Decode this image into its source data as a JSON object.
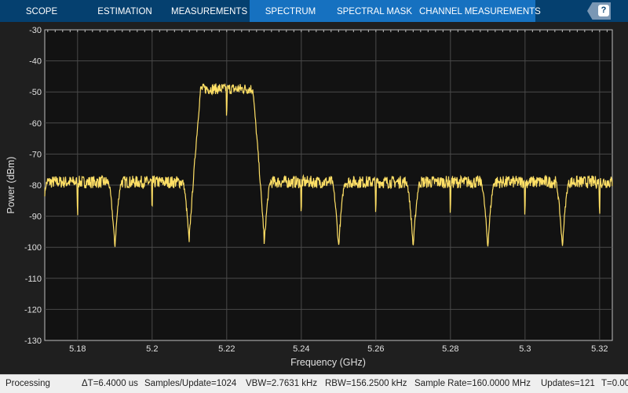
{
  "tabs": {
    "scope": "SCOPE",
    "estimation": "ESTIMATION",
    "measurements": "MEASUREMENTS",
    "spectrum": "SPECTRUM",
    "spectral_mask": "SPECTRAL MASK",
    "channel_measurements": "CHANNEL MEASUREMENTS",
    "help": "?"
  },
  "colors": {
    "trace": "#ffe066",
    "tabbar": "#05406f",
    "active_group": "#1671c0"
  },
  "chart_data": {
    "type": "line",
    "xlabel": "Frequency (GHz)",
    "ylabel": "Power (dBm)",
    "xlim": [
      5.1712,
      5.3234
    ],
    "ylim": [
      -130,
      -30
    ],
    "xticks": [
      "5.18",
      "5.2",
      "5.22",
      "5.24",
      "5.26",
      "5.28",
      "5.3",
      "5.32"
    ],
    "xtick_values": [
      5.18,
      5.2,
      5.22,
      5.24,
      5.26,
      5.28,
      5.3,
      5.32
    ],
    "yticks": [
      "-30",
      "-40",
      "-50",
      "-60",
      "-70",
      "-80",
      "-90",
      "-100",
      "-110",
      "-120",
      "-130"
    ],
    "ytick_values": [
      -30,
      -40,
      -50,
      -60,
      -70,
      -80,
      -90,
      -100,
      -110,
      -120,
      -130
    ],
    "grid": true,
    "channels": [
      {
        "center_ghz": 5.18,
        "level_dbm": -79
      },
      {
        "center_ghz": 5.2,
        "level_dbm": -79
      },
      {
        "center_ghz": 5.22,
        "level_dbm": -49
      },
      {
        "center_ghz": 5.24,
        "level_dbm": -79
      },
      {
        "center_ghz": 5.26,
        "level_dbm": -79
      },
      {
        "center_ghz": 5.28,
        "level_dbm": -79
      },
      {
        "center_ghz": 5.3,
        "level_dbm": -79
      },
      {
        "center_ghz": 5.32,
        "level_dbm": -79
      }
    ],
    "edge_floor_dbm": -100
  },
  "status": {
    "state": "Processing",
    "delta_t": "ΔT=6.4000 us",
    "samples": "Samples/Update=1024",
    "vbw": "VBW=2.7631 kHz",
    "rbw": "RBW=156.2500 kHz",
    "sample_rate": "Sample Rate=160.0000 MHz",
    "updates": "Updates=121",
    "t": "T=0.00"
  }
}
